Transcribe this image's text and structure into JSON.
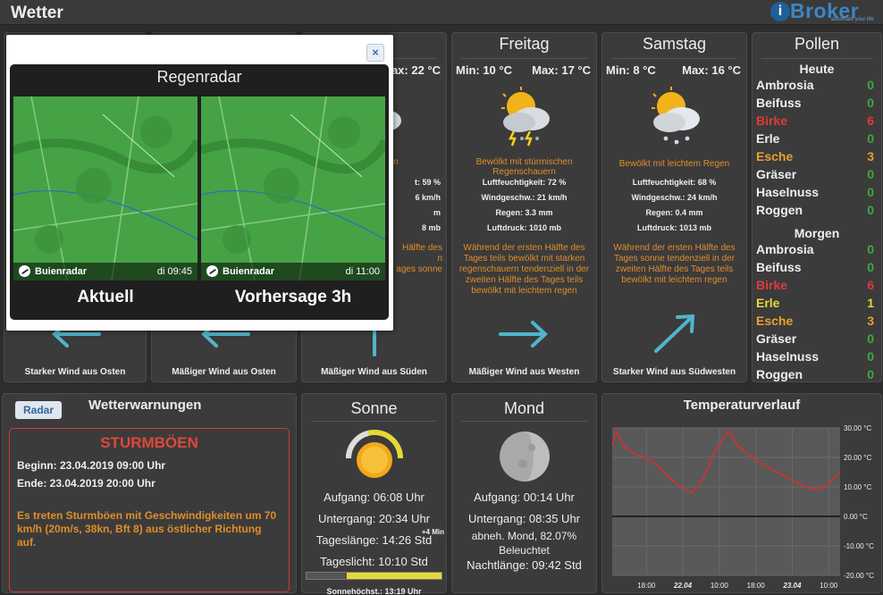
{
  "app": {
    "title": "Wetter",
    "logo_text": "Broker",
    "logo_letter": "i",
    "logo_sub": "automate your life"
  },
  "days": [
    {
      "id": "hidden1",
      "name": "",
      "min": "",
      "max": "",
      "wind_text": "Starker Wind aus Osten",
      "wind_dir": "west"
    },
    {
      "id": "hidden2",
      "name": "",
      "min": "",
      "max": "",
      "wind_text": "Mäßiger Wind aus Osten",
      "wind_dir": "west"
    },
    {
      "id": "donnerstag",
      "name": "tag",
      "min": "",
      "max": "ax: 22 °C",
      "desc": "htem Regen",
      "stats": [
        "t: 59 %",
        "6 km/h",
        "m",
        "8 mb"
      ],
      "forecast": [
        "Hälfte des",
        "n",
        "ages sonne"
      ],
      "wind_text": "Mäßiger Wind aus Süden",
      "wind_dir": "north"
    },
    {
      "id": "freitag",
      "name": "Freitag",
      "min": "Min: 10 °C",
      "max": "Max: 17 °C",
      "desc": "Bewölkt mit stürmischen Regenschauern",
      "stats": [
        "Luftfeuchtigkeit: 72 %",
        "Windgeschw.: 21 km/h",
        "Regen: 3.3 mm",
        "Luftdruck: 1010 mb"
      ],
      "forecast": [
        "Während der ersten Hälfte des Tages teils bewölkt mit starken regenschauern tendenziell in der zweiten Hälfte des Tages teils bewölkt mit leichtem regen"
      ],
      "wind_text": "Mäßiger Wind aus Westen",
      "wind_dir": "east"
    },
    {
      "id": "samstag",
      "name": "Samstag",
      "min": "Min: 8 °C",
      "max": "Max: 16 °C",
      "desc": "Bewölkt mit leichtem Regen",
      "stats": [
        "Luftfeuchtigkeit: 68 %",
        "Windgeschw.: 24 km/h",
        "Regen: 0.4 mm",
        "Luftdruck: 1013 mb"
      ],
      "forecast": [
        "Während der ersten Hälfte des Tages sonne tendenziell in der zweiten Hälfte des Tages teils bewölkt mit leichtem regen"
      ],
      "wind_text": "Starker Wind aus Südwesten",
      "wind_dir": "northeast"
    }
  ],
  "pollen": {
    "title": "Pollen",
    "today_label": "Heute",
    "tomorrow_label": "Morgen",
    "today": [
      {
        "name": "Ambrosia",
        "value": "0",
        "color": "#eeeeee",
        "vcolor": "#3caa3c"
      },
      {
        "name": "Beifuss",
        "value": "0",
        "color": "#eeeeee",
        "vcolor": "#3caa3c"
      },
      {
        "name": "Birke",
        "value": "6",
        "color": "#e03a3a",
        "vcolor": "#e03a3a"
      },
      {
        "name": "Erle",
        "value": "0",
        "color": "#eeeeee",
        "vcolor": "#3caa3c"
      },
      {
        "name": "Esche",
        "value": "3",
        "color": "#e8a030",
        "vcolor": "#e8a030"
      },
      {
        "name": "Gräser",
        "value": "0",
        "color": "#eeeeee",
        "vcolor": "#3caa3c"
      },
      {
        "name": "Haselnuss",
        "value": "0",
        "color": "#eeeeee",
        "vcolor": "#3caa3c"
      },
      {
        "name": "Roggen",
        "value": "0",
        "color": "#eeeeee",
        "vcolor": "#3caa3c"
      }
    ],
    "tomorrow": [
      {
        "name": "Ambrosia",
        "value": "0",
        "color": "#eeeeee",
        "vcolor": "#3caa3c"
      },
      {
        "name": "Beifuss",
        "value": "0",
        "color": "#eeeeee",
        "vcolor": "#3caa3c"
      },
      {
        "name": "Birke",
        "value": "6",
        "color": "#e03a3a",
        "vcolor": "#e03a3a"
      },
      {
        "name": "Erle",
        "value": "1",
        "color": "#e6d83a",
        "vcolor": "#e6d83a"
      },
      {
        "name": "Esche",
        "value": "3",
        "color": "#e8a030",
        "vcolor": "#e8a030"
      },
      {
        "name": "Gräser",
        "value": "0",
        "color": "#eeeeee",
        "vcolor": "#3caa3c"
      },
      {
        "name": "Haselnuss",
        "value": "0",
        "color": "#eeeeee",
        "vcolor": "#3caa3c"
      },
      {
        "name": "Roggen",
        "value": "0",
        "color": "#eeeeee",
        "vcolor": "#3caa3c"
      }
    ]
  },
  "warnings": {
    "radar_label": "Radar",
    "title": "Wetterwarnungen",
    "event": "STURMBÖEN",
    "begin": "Beginn: 23.04.2019 09:00 Uhr",
    "end": "Ende: 23.04.2019 20:00 Uhr",
    "description": "Es treten Sturmböen mit Geschwindigkeiten um 70 km/h (20m/s, 38kn, Bft 8) aus östlicher Richtung auf."
  },
  "sun": {
    "title": "Sonne",
    "sunrise": "Aufgang: 06:08 Uhr",
    "sunset": "Untergang: 20:34 Uhr",
    "plus": "+4 Min",
    "daylength": "Tageslänge: 14:26 Std",
    "daylight": "Tageslicht: 10:10 Std",
    "daylight_fraction": 0.7,
    "noon": "Sonnehöchst.: 13:19 Uhr"
  },
  "moon": {
    "title": "Mond",
    "moonrise": "Aufgang: 00:14 Uhr",
    "moonset": "Untergang: 08:35 Uhr",
    "phase": "abneh. Mond, 82.07%",
    "lit": "Beleuchtet",
    "nightlength": "Nachtlänge: 09:42 Std"
  },
  "chart_data": {
    "type": "line",
    "title": "Temperaturverlauf",
    "y_ticks": [
      "30.00 °C",
      "20.00 °C",
      "10.00 °C",
      "0.00 °C",
      "-10.00 °C",
      "-20.00 °C"
    ],
    "ylim": [
      -20,
      30
    ],
    "x_ticks": [
      "18:00",
      "22.04",
      "10:00",
      "18:00",
      "23.04",
      "10:00"
    ],
    "xlim": [
      0,
      60
    ],
    "grid": true,
    "series": [
      {
        "x": [
          0,
          1,
          3,
          6,
          9,
          12,
          15,
          18,
          21,
          24,
          27,
          30,
          31,
          33,
          36,
          39,
          42,
          45,
          48,
          51,
          54,
          57,
          60
        ],
        "y": [
          24,
          29,
          24,
          21,
          20,
          17,
          13,
          10,
          8,
          13,
          22,
          28,
          29,
          24,
          21,
          18,
          16,
          14,
          12,
          10,
          9,
          11,
          15
        ],
        "color": "#d63030"
      }
    ],
    "zero_line": 0
  },
  "radar": {
    "title": "Regenradar",
    "brand": "Buienradar",
    "current_time": "di 09:45",
    "forecast_time": "di 11:00",
    "current_label": "Aktuell",
    "forecast_label": "Vorhersage 3h",
    "close_label": "×"
  }
}
